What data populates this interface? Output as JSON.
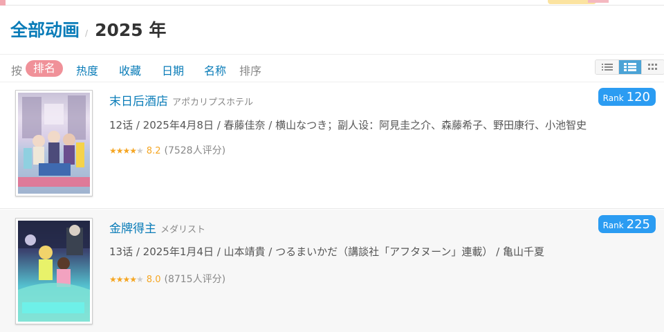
{
  "header": {
    "category": "全部动画",
    "separator": "/",
    "year": "2025 年"
  },
  "sortbar": {
    "prefix": "按",
    "options": [
      "排名",
      "热度",
      "收藏",
      "日期",
      "名称"
    ],
    "active": "排名",
    "suffix": "排序"
  },
  "view_modes": [
    "list-icon",
    "detailed-list-icon",
    "grid-icon"
  ],
  "view_active": "detailed-list-icon",
  "items": [
    {
      "title": "末日后酒店",
      "original_title": "アポカリプスホテル",
      "info": "12话 / 2025年4月8日 / 春藤佳奈 / 横山なつき；副人设：阿見圭之介、森藤希子、野田康行、小池智史",
      "stars": "★★★★",
      "stars_off": "★",
      "score": "8.2",
      "votes": "(7528人评分)",
      "rank_label": "Rank",
      "rank": "120",
      "cover_text": "アポカリプスホテル"
    },
    {
      "title": "金牌得主",
      "original_title": "メダリスト",
      "info": "13话 / 2025年1月4日 / 山本靖貴 / つるまいかだ（講談社「アフタヌーン」連載） / 亀山千夏",
      "stars": "★★★★",
      "stars_off": "★",
      "score": "8.0",
      "votes": "(8715人评分)",
      "rank_label": "Rank",
      "rank": "225",
      "cover_text": "メダリスト"
    }
  ],
  "colors": {
    "link": "#0a7cb8",
    "active_pill": "#f09199",
    "rank_badge": "#2b9cf2",
    "star": "#f5a623"
  }
}
